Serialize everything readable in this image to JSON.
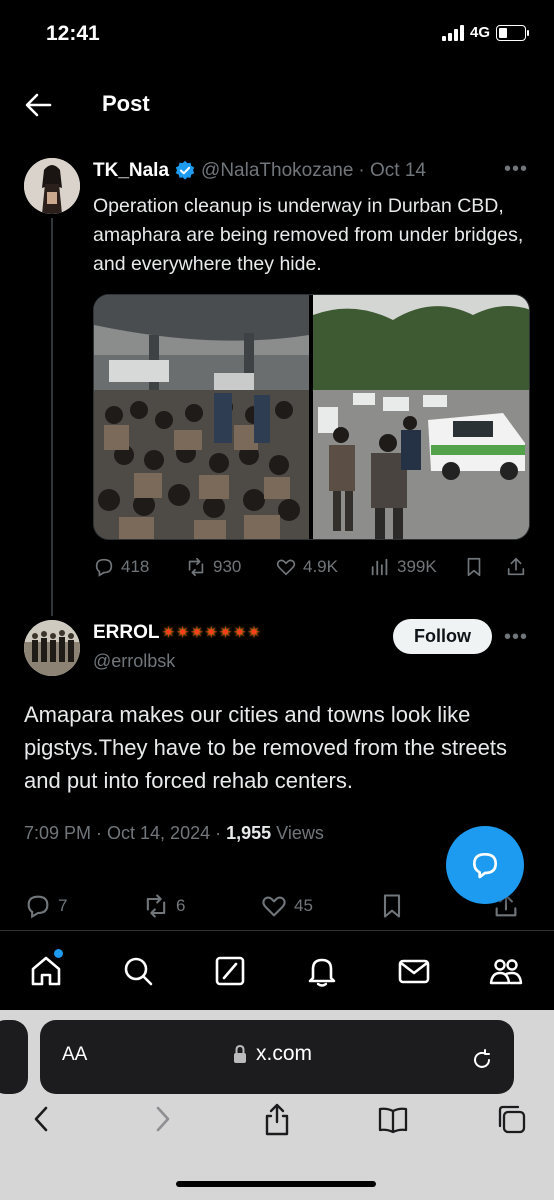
{
  "status_bar": {
    "time": "12:41",
    "network": "4G"
  },
  "header": {
    "title": "Post"
  },
  "quoted_post": {
    "name": "TK_Nala",
    "handle": "@NalaThokozane",
    "date": "· Oct 14",
    "text": "Operation cleanup is underway in Durban CBD, amaphara are being removed from under bridges, and everywhere they hide.",
    "stats": {
      "replies": "418",
      "reposts": "930",
      "likes": "4.9K",
      "views": "399K"
    }
  },
  "main_post": {
    "name": "ERROL",
    "handle": "@errolbsk",
    "follow_label": "Follow",
    "text": "Amapara makes our cities and towns look like pigstys.They have to be removed from the streets and put into forced rehab centers.",
    "time": "7:09 PM · Oct 14, 2024 · ",
    "views_count": "1,955",
    "views_label": " Views",
    "stats": {
      "replies": "7",
      "reposts": "6",
      "likes": "45"
    }
  },
  "browser": {
    "aa_label": "AA",
    "url": "x.com"
  },
  "colors": {
    "accent": "#1d9bf0",
    "background": "#000000",
    "muted": "#71767b"
  }
}
